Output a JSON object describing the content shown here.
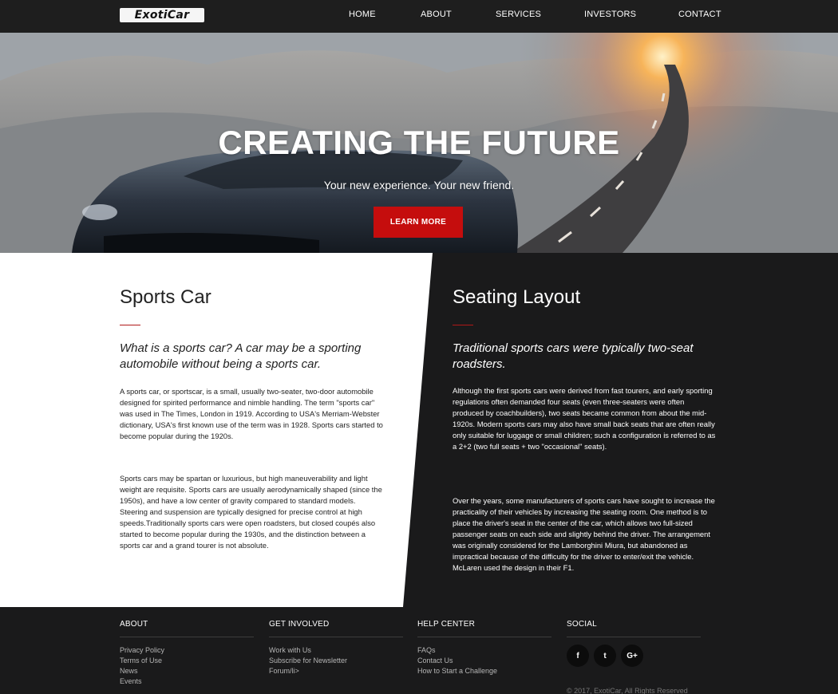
{
  "header": {
    "logo": "ExotiCar",
    "nav": [
      "HOME",
      "ABOUT",
      "SERVICES",
      "INVESTORS",
      "CONTACT"
    ]
  },
  "hero": {
    "title": "CREATING THE FUTURE",
    "subtitle": "Your new experience. Your new friend.",
    "button": "LEARN MORE"
  },
  "left": {
    "title": "Sports Car",
    "lead": "What is a sports car? A car may be a sporting automobile without being a sports car.",
    "p1": "A sports car, or sportscar, is a small, usually two-seater, two-door automobile designed for spirited performance and nimble handling. The term \"sports car\" was used in The Times, London in 1919. According to USA's Merriam-Webster dictionary, USA's first known use of the term was in 1928. Sports cars started to become popular during the 1920s.",
    "p2": "Sports cars may be spartan or luxurious, but high maneuverability and light weight are requisite. Sports cars are usually aerodynamically shaped (since the 1950s), and have a low center of gravity compared to standard models. Steering and suspension are typically designed for precise control at high speeds.Traditionally sports cars were open roadsters, but closed coupés also started to become popular during the 1930s, and the distinction between a sports car and a grand tourer is not absolute."
  },
  "right": {
    "title": "Seating Layout",
    "lead": "Traditional sports cars were typically two-seat roadsters.",
    "p1": "Although the first sports cars were derived from fast tourers, and early sporting regulations often demanded four seats (even three-seaters were often produced by coachbuilders), two seats became common from about the mid-1920s. Modern sports cars may also have small back seats that are often really only suitable for luggage or small children; such a configuration is referred to as a 2+2 (two full seats + two \"occasional\" seats).",
    "p2": "Over the years, some manufacturers of sports cars have sought to increase the practicality of their vehicles by increasing the seating room. One method is to place the driver's seat in the center of the car, which allows two full-sized passenger seats on each side and slightly behind the driver. The arrangement was originally considered for the Lamborghini Miura, but abandoned as impractical because of the difficulty for the driver to enter/exit the vehicle. McLaren used the design in their F1."
  },
  "footer": {
    "about": {
      "title": "ABOUT",
      "links": [
        "Privacy Policy",
        "Terms of Use",
        "News",
        "Events"
      ]
    },
    "involved": {
      "title": "GET INVOLVED",
      "links": [
        "Work with Us",
        "Subscribe for Newsletter",
        "Forum/li>"
      ]
    },
    "help": {
      "title": "HELP CENTER",
      "links": [
        "FAQs",
        "Contact Us",
        "How to Start a Challenge"
      ]
    },
    "social": {
      "title": "SOCIAL",
      "icons": [
        "f",
        "t",
        "G+"
      ]
    },
    "copyright": "© 2017, ExotiCar, All Rights Reserved"
  },
  "colors": {
    "accent": "#c50d0d",
    "dark": "#1a1a1b"
  }
}
